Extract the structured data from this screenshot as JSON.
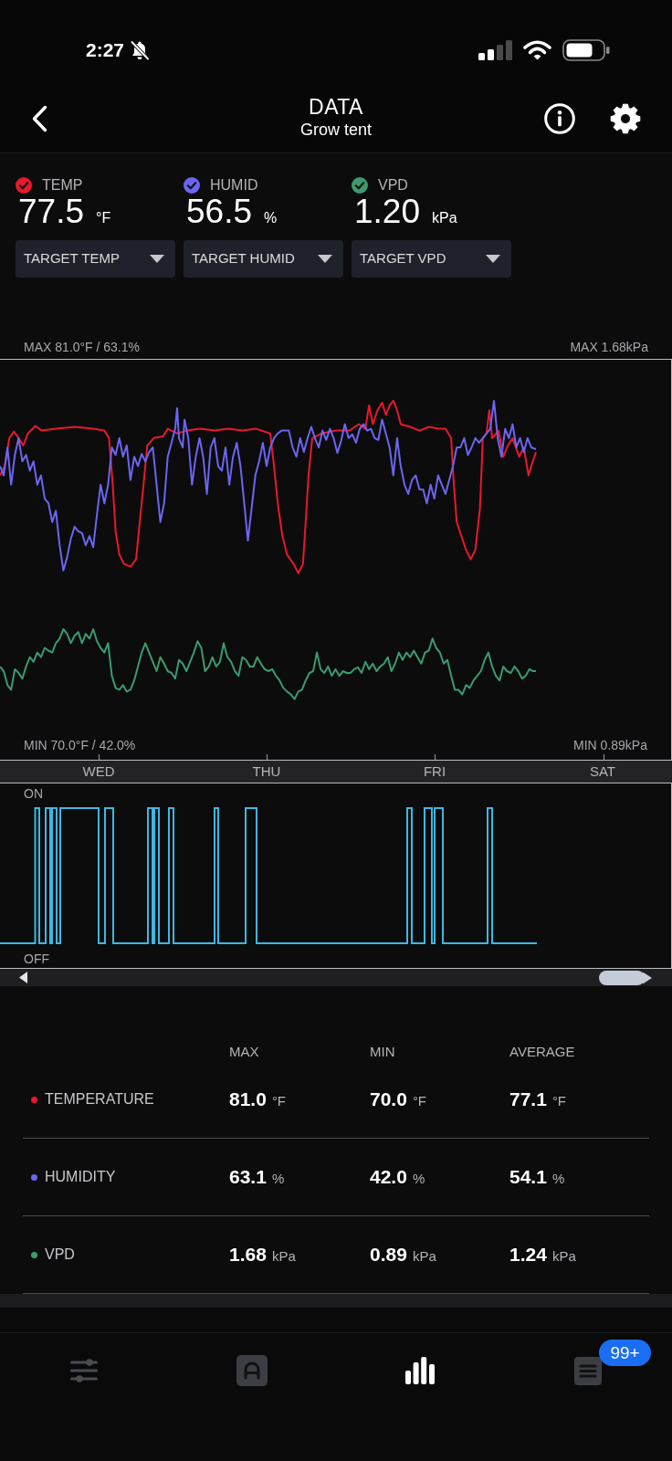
{
  "status_bar": {
    "time": "2:27"
  },
  "header": {
    "title": "DATA",
    "subtitle": "Grow tent"
  },
  "sensors": [
    {
      "label": "TEMP",
      "checked": true,
      "color": "#e8192c",
      "value": "77.5",
      "unit": "°F",
      "target": "TARGET TEMP"
    },
    {
      "label": "HUMID",
      "checked": true,
      "color": "#6b66f2",
      "value": "56.5",
      "unit": "%",
      "target": "TARGET HUMID"
    },
    {
      "label": "VPD",
      "checked": true,
      "color": "#3a9b6f",
      "value": "1.20",
      "unit": "kPa",
      "target": "TARGET VPD"
    }
  ],
  "chart": {
    "max_left": "MAX 81.0°F / 63.1%",
    "max_right": "MAX 1.68kPa",
    "min_left": "MIN 70.0°F / 42.0%",
    "min_right": "MIN 0.89kPa",
    "days": [
      "WED",
      "THU",
      "FRI",
      "SAT"
    ]
  },
  "switch_chart": {
    "on_label": "ON",
    "off_label": "OFF"
  },
  "stats": {
    "columns": [
      "MAX",
      "MIN",
      "AVERAGE"
    ],
    "rows": [
      {
        "name": "TEMPERATURE",
        "color": "#e8192c",
        "values": [
          {
            "value": "81.0",
            "unit": "°F"
          },
          {
            "value": "70.0",
            "unit": "°F"
          },
          {
            "value": "77.1",
            "unit": "°F"
          }
        ]
      },
      {
        "name": "HUMIDITY",
        "color": "#6b66f2",
        "values": [
          {
            "value": "63.1",
            "unit": "%"
          },
          {
            "value": "42.0",
            "unit": "%"
          },
          {
            "value": "54.1",
            "unit": "%"
          }
        ]
      },
      {
        "name": "VPD",
        "color": "#3a9b6f",
        "values": [
          {
            "value": "1.68",
            "unit": "kPa"
          },
          {
            "value": "0.89",
            "unit": "kPa"
          },
          {
            "value": "1.24",
            "unit": "kPa"
          }
        ]
      }
    ]
  },
  "tab_bar": {
    "tabs": [
      {
        "kind": "sliders",
        "selected": false
      },
      {
        "kind": "automation",
        "selected": false
      },
      {
        "kind": "chart",
        "selected": true
      },
      {
        "kind": "log",
        "selected": false,
        "badge": "99+"
      }
    ]
  }
}
